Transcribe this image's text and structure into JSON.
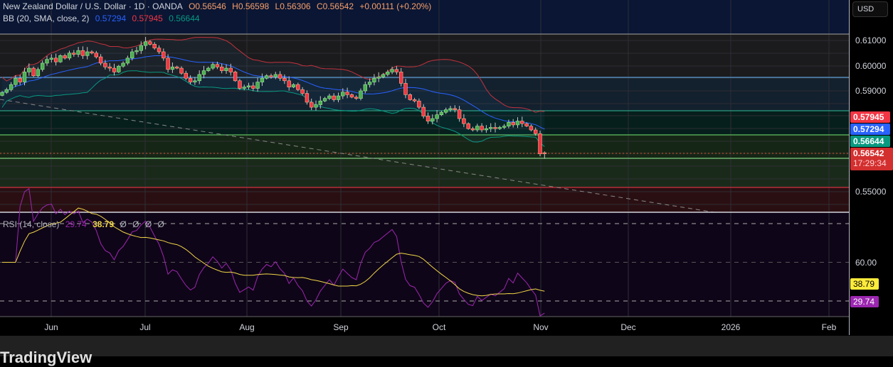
{
  "header": {
    "symbol": "New Zealand Dollar / U.S. Dollar · 1D · OANDA",
    "open": "O0.56546",
    "high": "H0.56598",
    "low": "L0.56306",
    "close": "C0.56542",
    "change": "+0.00111 (+0.20%)"
  },
  "bb_legend": {
    "label": "BB (20, SMA, close, 2)",
    "basis": "0.57294",
    "upper": "0.57945",
    "lower": "0.56644"
  },
  "rsi_legend": {
    "label": "RSI (14, close)",
    "rsi": "29.74",
    "ma": "38.79",
    "extra": [
      "Ø",
      "Ø",
      "Ø",
      "Ø"
    ]
  },
  "price_scale": {
    "currency": "USD",
    "ticks": [
      "0.61000",
      "0.60000",
      "0.59000",
      "0.55000"
    ],
    "badges": {
      "upper": "0.57945",
      "basis": "0.57294",
      "lower": "0.56644",
      "last": "0.56542",
      "countdown": "17:29:34"
    }
  },
  "rsi_scale": {
    "ticks": [
      "60.00"
    ],
    "badges": {
      "ma": "38.79",
      "rsi": "29.74"
    }
  },
  "time_axis": [
    "Jun",
    "Jul",
    "Aug",
    "Sep",
    "Oct",
    "Nov",
    "Dec",
    "2026",
    "Feb"
  ],
  "footer": {
    "brand": "TradingView"
  },
  "colors": {
    "up": "#4caf50",
    "down": "#f23645",
    "bb_upper": "#c2323e",
    "bb_basis": "#2962ff",
    "bb_lower": "#089981",
    "rsi": "#9c27b0",
    "rsi_ma": "#f0d648"
  },
  "chart_data": {
    "type": "candlestick",
    "interval": "1D",
    "closes": [
      0.5894,
      0.5905,
      0.5925,
      0.595,
      0.5935,
      0.5975,
      0.599,
      0.596,
      0.5985,
      0.601,
      0.6025,
      0.603,
      0.6015,
      0.604,
      0.603,
      0.605,
      0.6045,
      0.606,
      0.604,
      0.6055,
      0.605,
      0.6035,
      0.601,
      0.5995,
      0.599,
      0.5975,
      0.5998,
      0.601,
      0.603,
      0.6055,
      0.606,
      0.608,
      0.6095,
      0.6085,
      0.607,
      0.6055,
      0.603,
      0.5985,
      0.5995,
      0.599,
      0.597,
      0.595,
      0.5935,
      0.594,
      0.5965,
      0.598,
      0.599,
      0.6005,
      0.5995,
      0.598,
      0.599,
      0.5975,
      0.594,
      0.591,
      0.5915,
      0.592,
      0.591,
      0.5935,
      0.595,
      0.596,
      0.5955,
      0.5965,
      0.595,
      0.594,
      0.5915,
      0.5925,
      0.5905,
      0.589,
      0.5855,
      0.5835,
      0.5845,
      0.586,
      0.587,
      0.588,
      0.5865,
      0.588,
      0.5895,
      0.5885,
      0.5875,
      0.587,
      0.59,
      0.5925,
      0.5935,
      0.595,
      0.5955,
      0.5965,
      0.5975,
      0.5985,
      0.5975,
      0.593,
      0.5885,
      0.5865,
      0.586,
      0.5835,
      0.58,
      0.578,
      0.579,
      0.5805,
      0.5815,
      0.5825,
      0.583,
      0.5825,
      0.579,
      0.577,
      0.575,
      0.5745,
      0.576,
      0.5745,
      0.575,
      0.5755,
      0.575,
      0.5755,
      0.576,
      0.5775,
      0.5765,
      0.578,
      0.577,
      0.576,
      0.5745,
      0.573,
      0.565,
      0.56542
    ],
    "last": {
      "open": 0.56546,
      "high": 0.56598,
      "low": 0.56306,
      "close": 0.56542
    },
    "horizontal_levels": [
      0.5955,
      0.582,
      0.5725,
      0.5635,
      0.552
    ],
    "price_range": [
      0.5422,
      0.6237
    ],
    "rsi_levels": [
      70,
      50,
      30
    ]
  }
}
